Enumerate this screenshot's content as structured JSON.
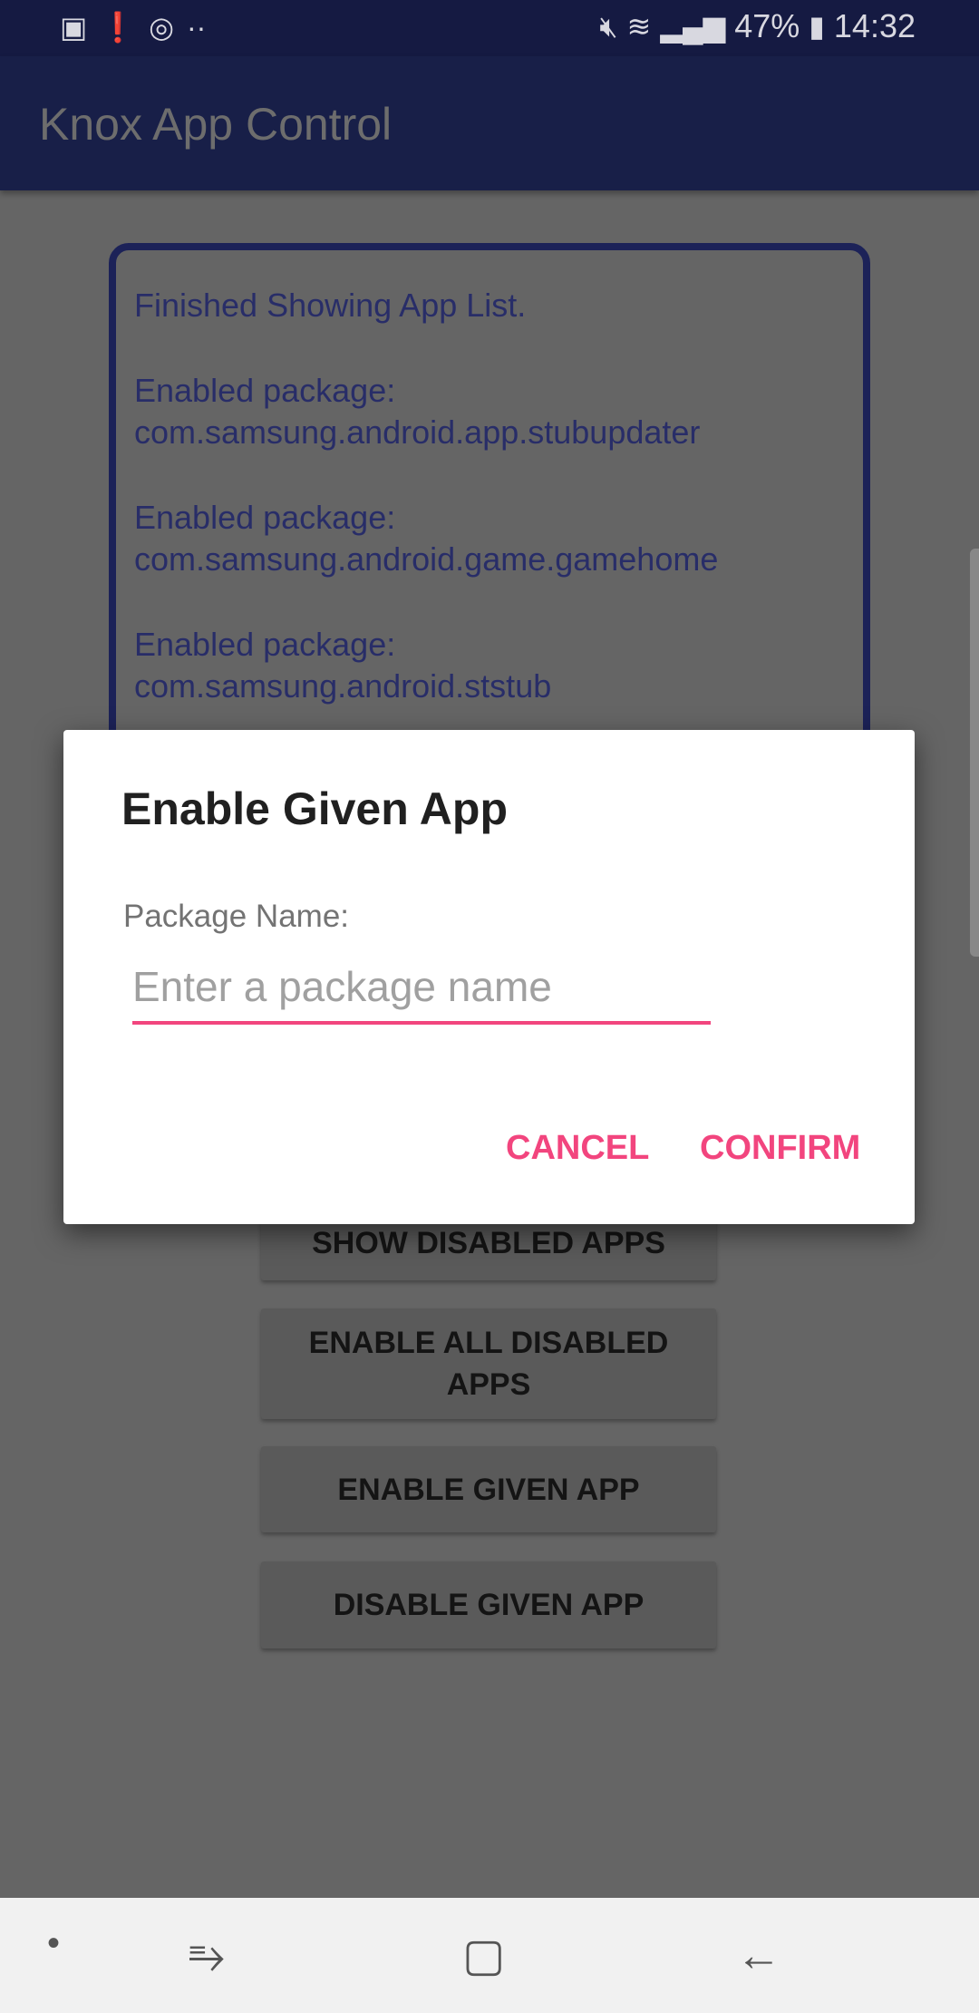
{
  "status_bar": {
    "icons": [
      "gallery-icon",
      "alert-icon",
      "sync-icon",
      "more-dots-icon"
    ],
    "right_icons": [
      "mute-icon",
      "wifi-icon",
      "signal-icon"
    ],
    "battery": "47%",
    "time": "14:32"
  },
  "app_bar": {
    "title": "Knox App Control"
  },
  "log": {
    "lines": [
      "Finished Showing App List.",
      "Enabled package:\ncom.samsung.android.app.stubupdater",
      "Enabled package:\ncom.samsung.android.game.gamehome",
      "Enabled package:\ncom.samsung.android.ststub"
    ]
  },
  "buttons": [
    "SHOW DISABLED APPS",
    "ENABLE ALL DISABLED APPS",
    "ENABLE GIVEN APP",
    "DISABLE GIVEN APP"
  ],
  "dialog": {
    "title": "Enable Given App",
    "label": "Package Name:",
    "input_value": "",
    "placeholder": "Enter a package name",
    "cancel": "CANCEL",
    "confirm": "CONFIRM"
  },
  "colors": {
    "accent": "#f2457e",
    "primary": "#1a237e"
  }
}
